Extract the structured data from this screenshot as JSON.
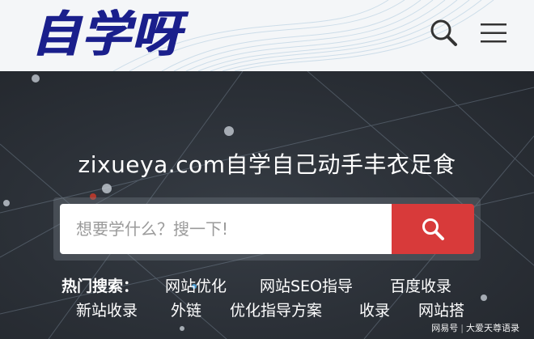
{
  "header": {
    "logo_text": "自学呀",
    "brand_color": "#1a1f8c",
    "search_icon": "search-icon",
    "menu_icon": "hamburger-menu-icon"
  },
  "hero": {
    "tagline": "zixueya.com自学自己动手丰衣足食",
    "search": {
      "placeholder": "想要学什么？搜一下!",
      "button_icon": "search-icon",
      "button_color": "#d83a3a"
    },
    "hot_label": "热门搜索：",
    "hot_links": [
      "网站优化",
      "网站SEO指导",
      "百度收录",
      "新站收录",
      "外链",
      "优化指导方案",
      "收录",
      "网站搭"
    ]
  },
  "watermark": {
    "source": "网易号",
    "author": "大爱天尊语录"
  }
}
